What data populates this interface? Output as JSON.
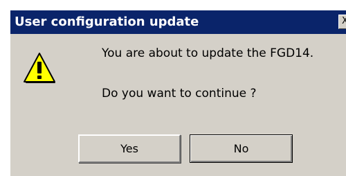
{
  "dialog": {
    "title": "User configuration update",
    "close_glyph": "X",
    "icon": "warning-icon",
    "message": "You are about to update the FGD14.",
    "question": "Do you want to continue ?",
    "buttons": {
      "yes_label": "Yes",
      "no_label": "No"
    },
    "colors": {
      "titlebar": "#0a246a",
      "face": "#d4d0c8",
      "warning_fill": "#ffff00"
    }
  }
}
